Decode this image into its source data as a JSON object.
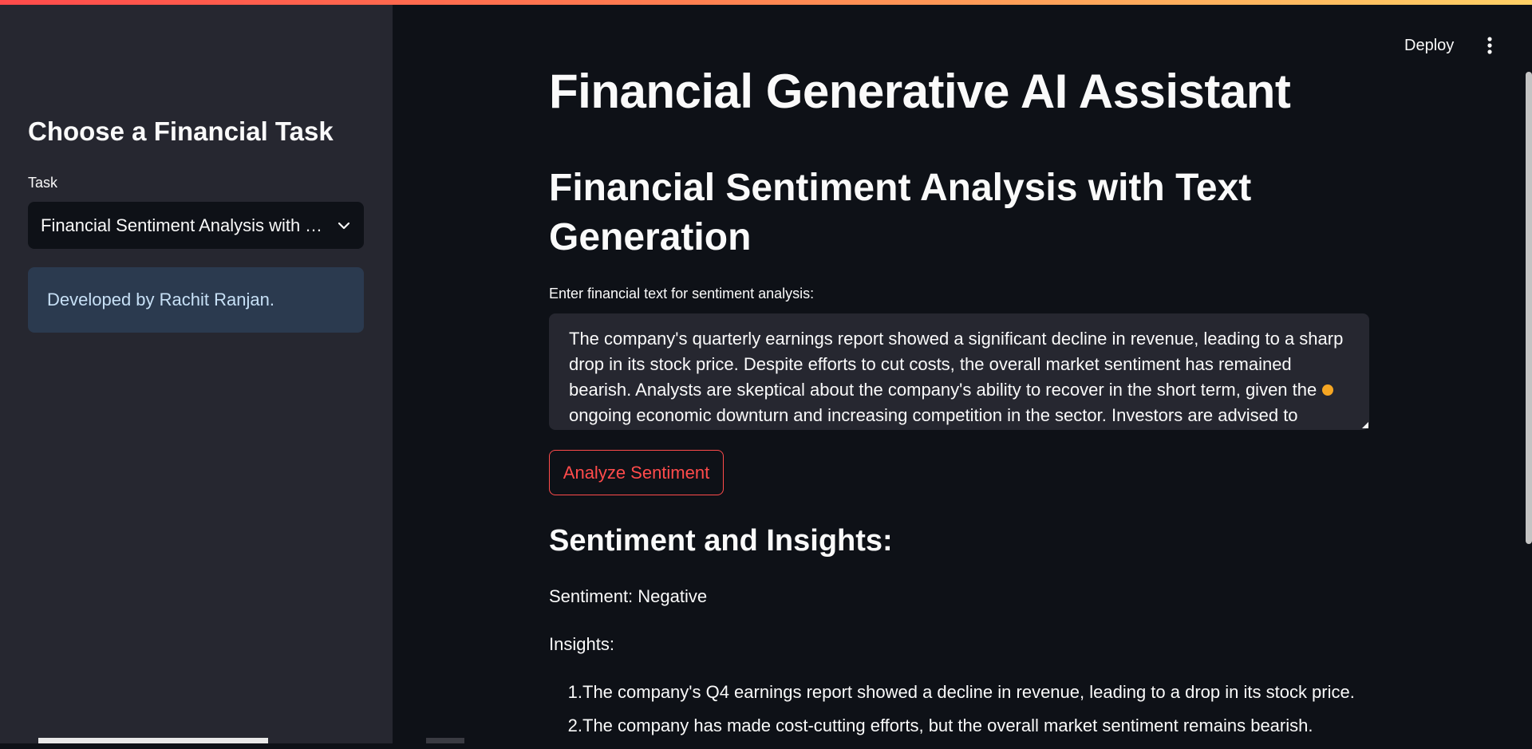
{
  "app": {
    "deploy_label": "Deploy",
    "menu_icon": "more-vertical-icon",
    "accent_color": "#ff4b4b"
  },
  "sidebar": {
    "title": "Choose a Financial Task",
    "task_label": "Task",
    "task_selected": "Financial Sentiment Analysis with Text Generation",
    "info_text": "Developed by Rachit Ranjan."
  },
  "main": {
    "title": "Financial Generative AI Assistant",
    "subtitle": "Financial Sentiment Analysis with Text Generation",
    "input_label": "Enter financial text for sentiment analysis:",
    "input_value": "The company's quarterly earnings report showed a significant decline in revenue, leading to a sharp drop in its stock price. Despite efforts to cut costs, the overall market sentiment has remained bearish. Analysts are skeptical about the company's ability to recover in the short term, given the ongoing economic downturn and increasing competition in the sector. Investors are advised to",
    "analyze_button": "Analyze Sentiment",
    "results_heading": "Sentiment and Insights:",
    "sentiment_line": "Sentiment: Negative",
    "insights_label": "Insights:",
    "insights": [
      {
        "num": "1.",
        "text": "The company's Q4 earnings report showed a decline in revenue, leading to a drop in its stock price."
      },
      {
        "num": "2.",
        "text": "The company has made cost-cutting efforts, but the overall market sentiment remains bearish."
      }
    ]
  }
}
